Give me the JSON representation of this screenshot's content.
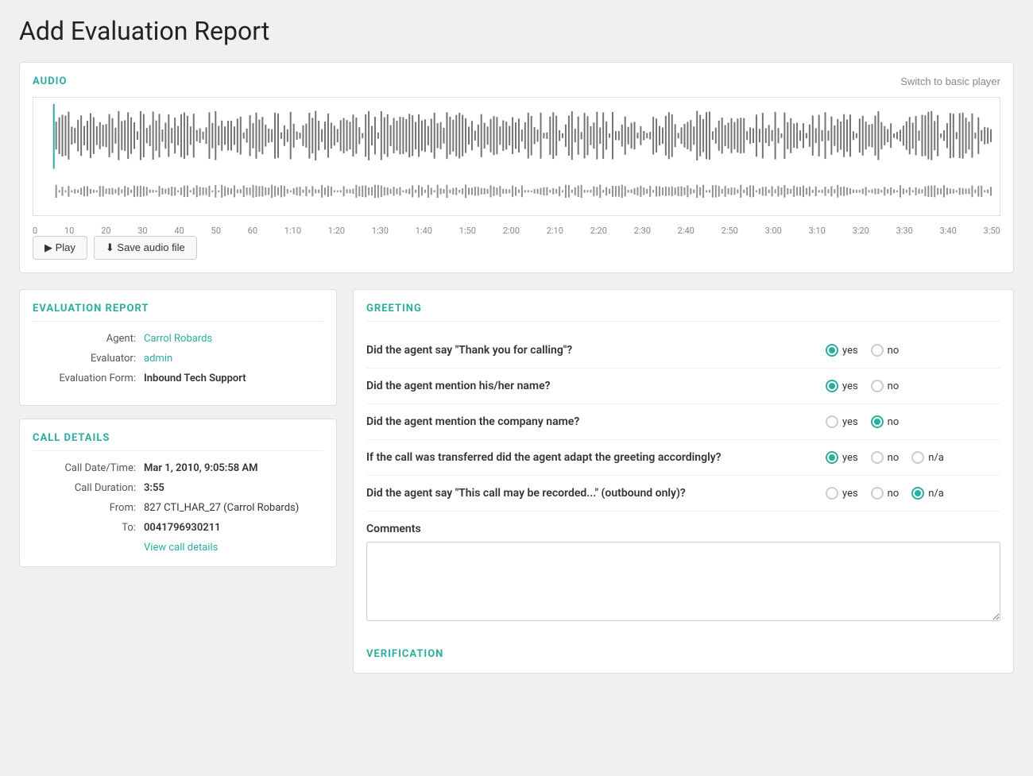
{
  "page": {
    "title": "Add Evaluation Report"
  },
  "audio": {
    "section_title": "AUDIO",
    "switch_player_label": "Switch to basic player",
    "play_label": "▶ Play",
    "save_label": "⬇ Save audio file",
    "timeline_labels": [
      "0",
      "10",
      "20",
      "30",
      "40",
      "50",
      "60",
      "1:10",
      "1:20",
      "1:30",
      "1:40",
      "1:50",
      "2:00",
      "2:10",
      "2:20",
      "2:30",
      "2:40",
      "2:50",
      "3:00",
      "3:10",
      "3:20",
      "3:30",
      "3:40",
      "3:50"
    ]
  },
  "evaluation_report": {
    "section_title": "EVALUATION REPORT",
    "agent_label": "Agent:",
    "agent_value": "Carrol Robards",
    "evaluator_label": "Evaluator:",
    "evaluator_value": "admin",
    "form_label": "Evaluation Form:",
    "form_value": "Inbound Tech Support"
  },
  "call_details": {
    "section_title": "CALL DETAILS",
    "date_label": "Call Date/Time:",
    "date_value": "Mar 1, 2010, 9:05:58 AM",
    "duration_label": "Call Duration:",
    "duration_value": "3:55",
    "from_label": "From:",
    "from_value": "827 CTI_HAR_27 (Carrol Robards)",
    "from_number": "827 CTI_HAR_27",
    "from_name": "Carrol Robards",
    "to_label": "To:",
    "to_value": "0041796930211",
    "view_details": "View call details"
  },
  "greeting": {
    "section_title": "GREETING",
    "questions": [
      {
        "id": "q1",
        "text": "Did the agent say \"Thank you for calling\"?",
        "options": [
          "yes",
          "no"
        ],
        "selected": "yes"
      },
      {
        "id": "q2",
        "text": "Did the agent mention his/her name?",
        "options": [
          "yes",
          "no"
        ],
        "selected": "yes"
      },
      {
        "id": "q3",
        "text": "Did the agent mention the company name?",
        "options": [
          "yes",
          "no"
        ],
        "selected": "no"
      },
      {
        "id": "q4",
        "text": "If the call was transferred did the agent adapt the greeting accordingly?",
        "options": [
          "yes",
          "no",
          "n/a"
        ],
        "selected": "yes"
      },
      {
        "id": "q5",
        "text": "Did the agent say \"This call may be recorded...\" (outbound only)?",
        "options": [
          "yes",
          "no",
          "n/a"
        ],
        "selected": "n/a"
      }
    ],
    "comments_label": "Comments"
  },
  "verification": {
    "section_title": "VERIFICATION"
  }
}
